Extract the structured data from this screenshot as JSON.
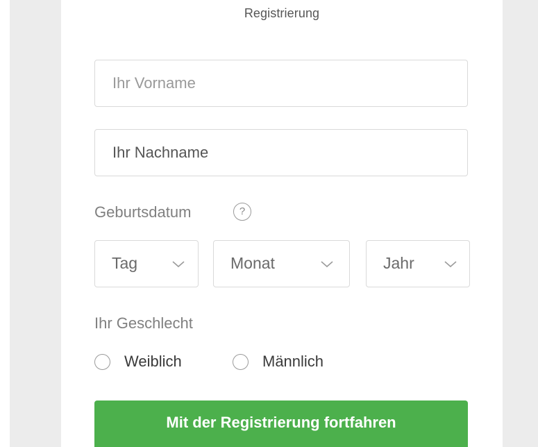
{
  "form": {
    "title": "Registrierung",
    "firstname_placeholder": "Ihr Vorname",
    "lastname_placeholder": "Ihr Nachname",
    "birthdate_label": "Geburtsdatum",
    "help_glyph": "?",
    "day_label": "Tag",
    "month_label": "Monat",
    "year_label": "Jahr",
    "gender_label": "Ihr Geschlecht",
    "gender_female": "Weiblich",
    "gender_male": "Männlich",
    "submit_label": "Mit der Registrierung fortfahren"
  },
  "colors": {
    "page_background": "#ececec",
    "card_background": "#ffffff",
    "submit_green": "#4cb04c"
  },
  "icons": {
    "help": "help-circle-icon",
    "select_arrow": "chevron-down-icon"
  }
}
